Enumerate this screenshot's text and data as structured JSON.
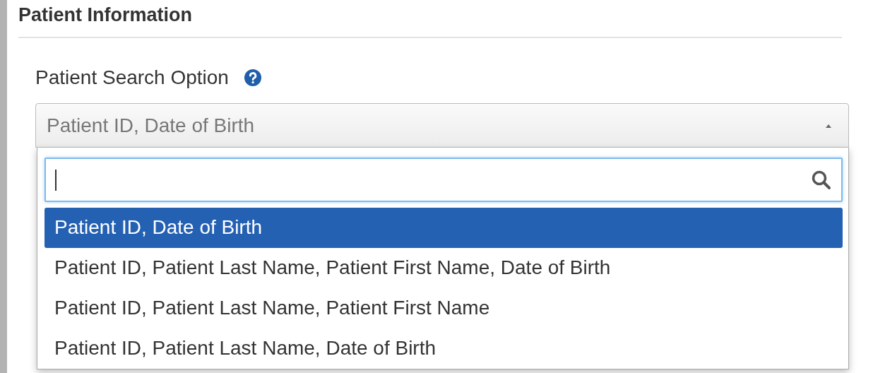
{
  "section": {
    "title": "Patient Information"
  },
  "search_option": {
    "label": "Patient Search Option",
    "value": "Patient ID, Date of Birth",
    "expanded": true,
    "options": [
      {
        "label": "Patient ID, Date of Birth",
        "selected": true
      },
      {
        "label": "Patient ID, Patient Last Name, Patient First Name, Date of Birth",
        "selected": false
      },
      {
        "label": "Patient ID, Patient Last Name, Patient First Name",
        "selected": false
      },
      {
        "label": "Patient ID, Patient Last Name, Date of Birth",
        "selected": false
      }
    ]
  }
}
